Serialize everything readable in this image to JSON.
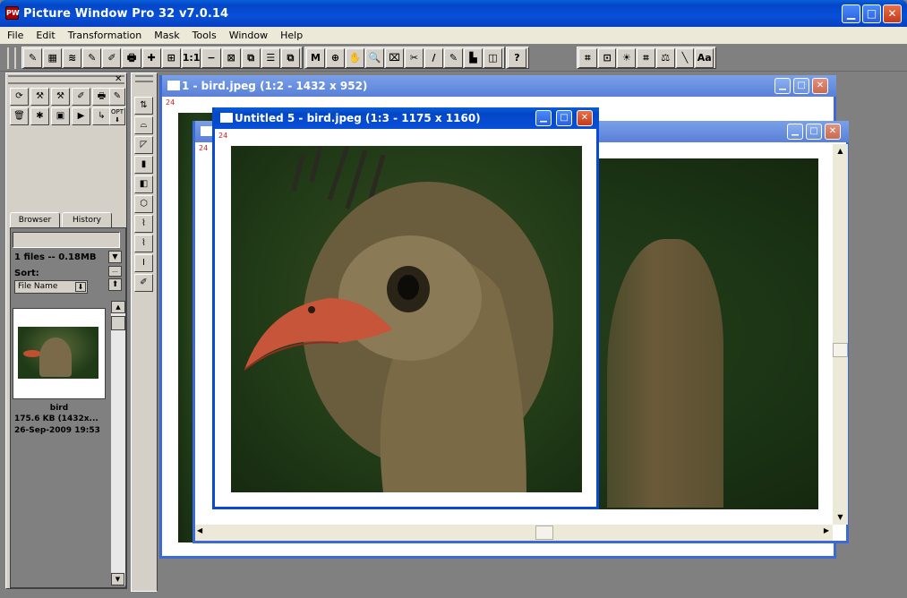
{
  "app": {
    "title": "Picture Window Pro 32  v7.0.14",
    "icon_label": "PW"
  },
  "menu": [
    "File",
    "Edit",
    "Transformation",
    "Mask",
    "Tools",
    "Window",
    "Help"
  ],
  "toolbar": {
    "group1": [
      "✎",
      "▦",
      "≋",
      "✎",
      "✐",
      "🖶",
      "✚",
      "⊞",
      "1:1",
      "−",
      "⊠",
      "⧉",
      "☰",
      "⧉"
    ],
    "group2": [
      "M",
      "⊕",
      "✋",
      "🔍",
      "⌧",
      "✂",
      "/",
      "✎",
      "▙",
      "◫"
    ],
    "group3": [
      "?"
    ],
    "group4": [
      "⌗",
      "⊡",
      "☀",
      "⌗",
      "⚖",
      "╲",
      "Aa"
    ]
  },
  "panel": {
    "tabs": [
      "Browser",
      "History"
    ],
    "file_count": "1 files -- 0.18MB",
    "sort_label": "Sort:",
    "sort_value": "File Name",
    "thumb": {
      "name": "bird",
      "size": "175.6 KB (1432x...",
      "date": "26-Sep-2009 19:53"
    },
    "opt_label": "OPT"
  },
  "windows": [
    {
      "title": "1 - bird.jpeg (1:2 - 1432 x 952)",
      "tag": "24"
    },
    {
      "title": "Untitled 5 - bird.jpeg (1:3 - 1175 x 1160)",
      "tag": "24"
    },
    {
      "title": "",
      "tag": "24"
    }
  ],
  "colors": {
    "title_blue": "#0a5fd8",
    "panel_gray": "#d4d0c8",
    "workspace": "#808080"
  }
}
